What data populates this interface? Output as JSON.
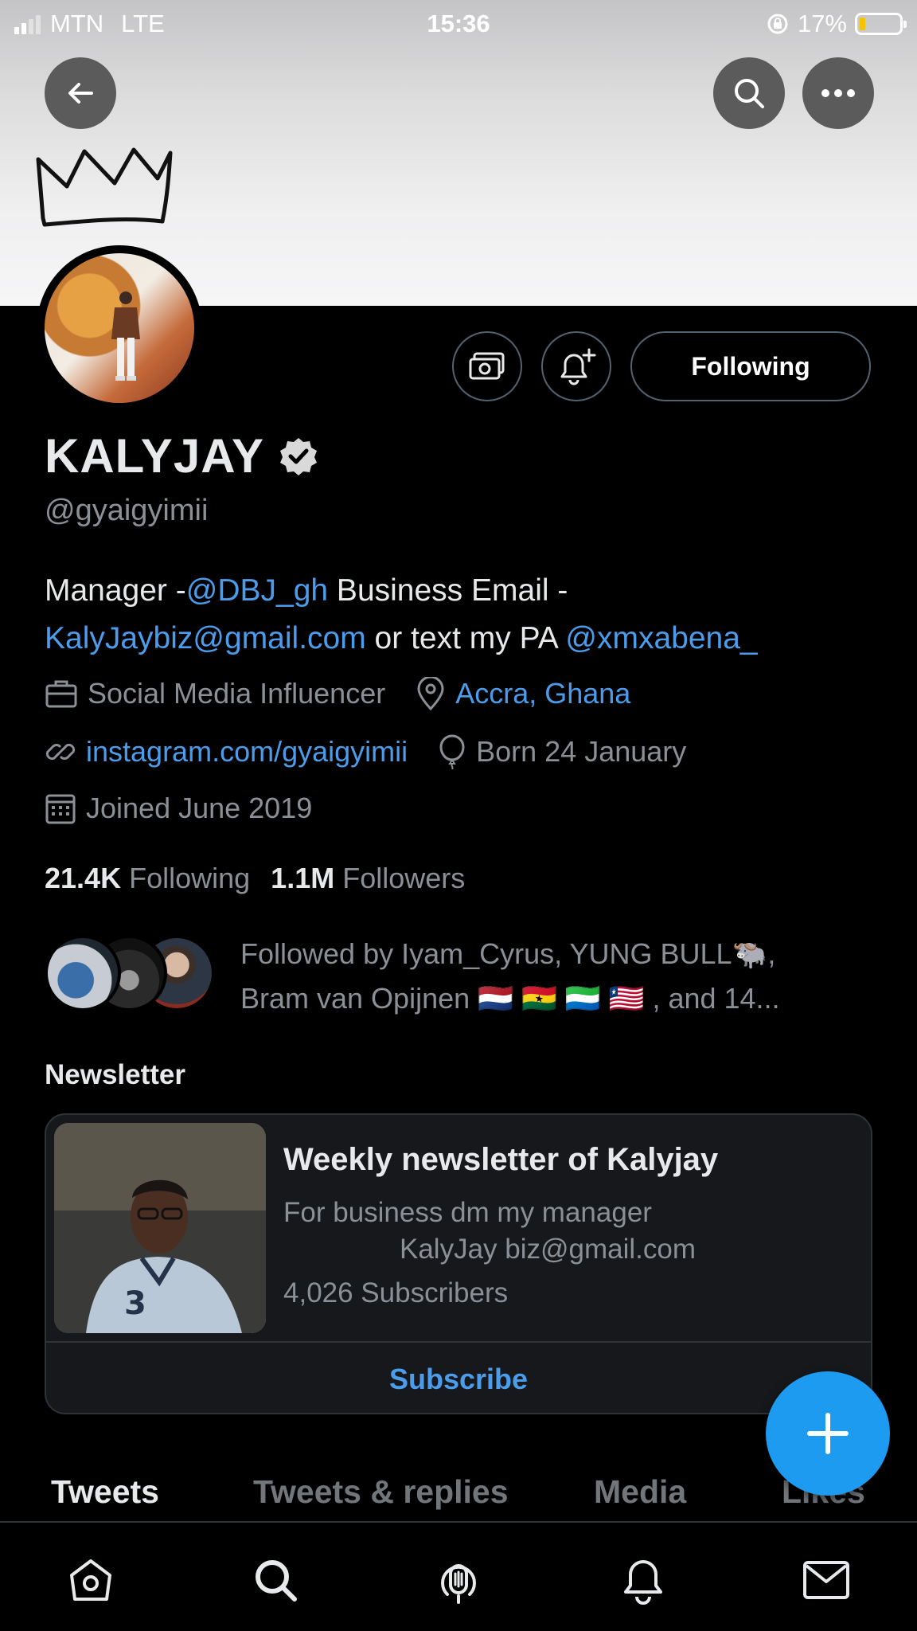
{
  "status_bar": {
    "carrier": "MTN",
    "network": "LTE",
    "time": "15:36",
    "battery_percent": "17%",
    "battery_level": 0.17
  },
  "header": {
    "back_icon": "arrow-left-icon",
    "search_icon": "search-icon",
    "more_icon": "more-horizontal-icon"
  },
  "profile": {
    "display_name": "KALYJAY",
    "verified": true,
    "handle": "@gyaigyimii",
    "following_button": "Following",
    "bio": {
      "prefix": "Manager -",
      "mention_manager": "@DBJ_gh",
      "middle": " Business Email - ",
      "email": "KalyJaybiz@gmail.com",
      "suffix": " or text my PA ",
      "mention_pa": "@xmxabena_"
    },
    "meta": {
      "category": "Social Media Influencer",
      "location": "Accra, Ghana",
      "website": "instagram.com/gyaigyimii",
      "birthday": "Born 24 January",
      "joined": "Joined June 2019"
    },
    "stats": {
      "following_count": "21.4K",
      "following_label": "Following",
      "followers_count": "1.1M",
      "followers_label": "Followers"
    },
    "followed_by": {
      "line1": "Followed by Iyam_Cyrus, YUNG BULL🐃,",
      "line2": "Bram van Opijnen 🇳🇱 🇬🇭 🇸🇱 🇱🇷 , and 14..."
    }
  },
  "newsletter": {
    "section_title": "Newsletter",
    "title": "Weekly newsletter of Kalyjay",
    "desc_line1": "For business dm my manager",
    "desc_line2": "KalyJay biz@gmail.com",
    "subscribers": "4,026 Subscribers",
    "subscribe_label": "Subscribe"
  },
  "tabs": [
    "Tweets",
    "Tweets & replies",
    "Media",
    "Likes"
  ],
  "bottom_nav": [
    "home-icon",
    "search-icon",
    "spaces-icon",
    "notifications-icon",
    "messages-icon"
  ],
  "colors": {
    "accent": "#1d9bf0",
    "link": "#4c9cec",
    "background": "#000000",
    "muted": "#8b9096"
  }
}
